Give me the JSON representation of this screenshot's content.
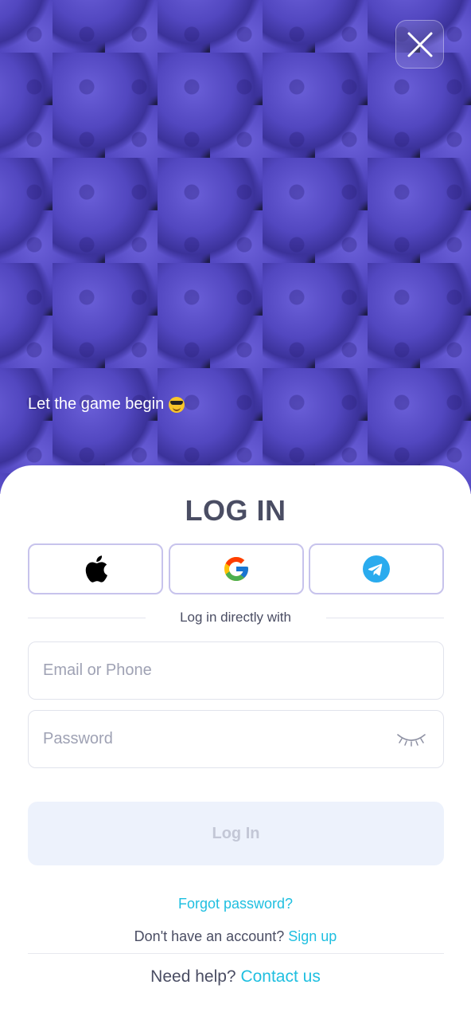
{
  "hero": {
    "tagline": "Let the game begin",
    "tagline_emoji": "smiling-face-with-sunglasses",
    "close_icon": "close-icon"
  },
  "login": {
    "title": "LOG IN",
    "social": [
      {
        "name": "apple",
        "icon": "apple-icon"
      },
      {
        "name": "google",
        "icon": "google-icon"
      },
      {
        "name": "telegram",
        "icon": "telegram-icon"
      }
    ],
    "divider_text": "Log in directly with",
    "email_placeholder": "Email or Phone",
    "password_placeholder": "Password",
    "password_toggle_icon": "eye-closed-icon",
    "submit_label": "Log In",
    "forgot_password": "Forgot password?",
    "no_account_text": "Don't have an account?",
    "signup_link": "Sign up",
    "need_help_text": "Need help?",
    "contact_link": "Contact us"
  },
  "colors": {
    "accent": "#1fbfe0",
    "title": "#4a4d63",
    "hero_bg": "#4e44b8",
    "button_disabled_bg": "#edf2fc",
    "social_border": "#c7c3ec"
  }
}
